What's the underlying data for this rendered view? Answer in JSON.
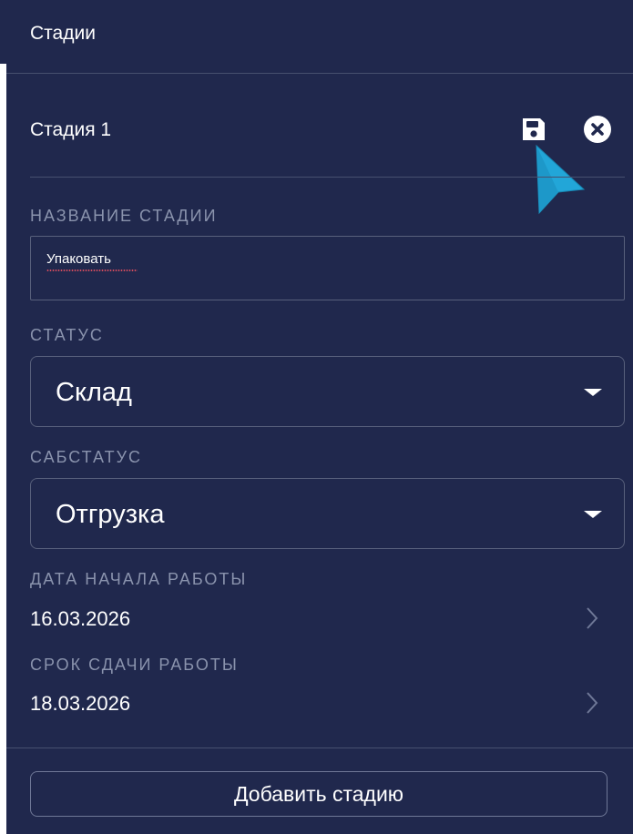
{
  "panel": {
    "title": "Стадии"
  },
  "stage": {
    "title": "Стадия 1",
    "save_icon": "save-icon",
    "close_icon": "close-circle-icon",
    "name_label": "НАЗВАНИЕ СТАДИИ",
    "name_value": "Упаковать",
    "status_label": "СТАТУС",
    "status_value": "Склад",
    "substatus_label": "САБСТАТУС",
    "substatus_value": "Отгрузка",
    "start_date_label": "ДАТА НАЧАЛА РАБОТЫ",
    "start_date_value": "16.03.2026",
    "due_date_label": "СРОК СДАЧИ РАБОТЫ",
    "due_date_value": "18.03.2026"
  },
  "actions": {
    "add_stage_label": "Добавить стадию"
  },
  "colors": {
    "panel_background": "#20284d",
    "label_text": "#8a93ad",
    "border": "#58607c",
    "cursor_fill": "#22a6d8",
    "spellcheck_underline": "#d04b5e"
  }
}
